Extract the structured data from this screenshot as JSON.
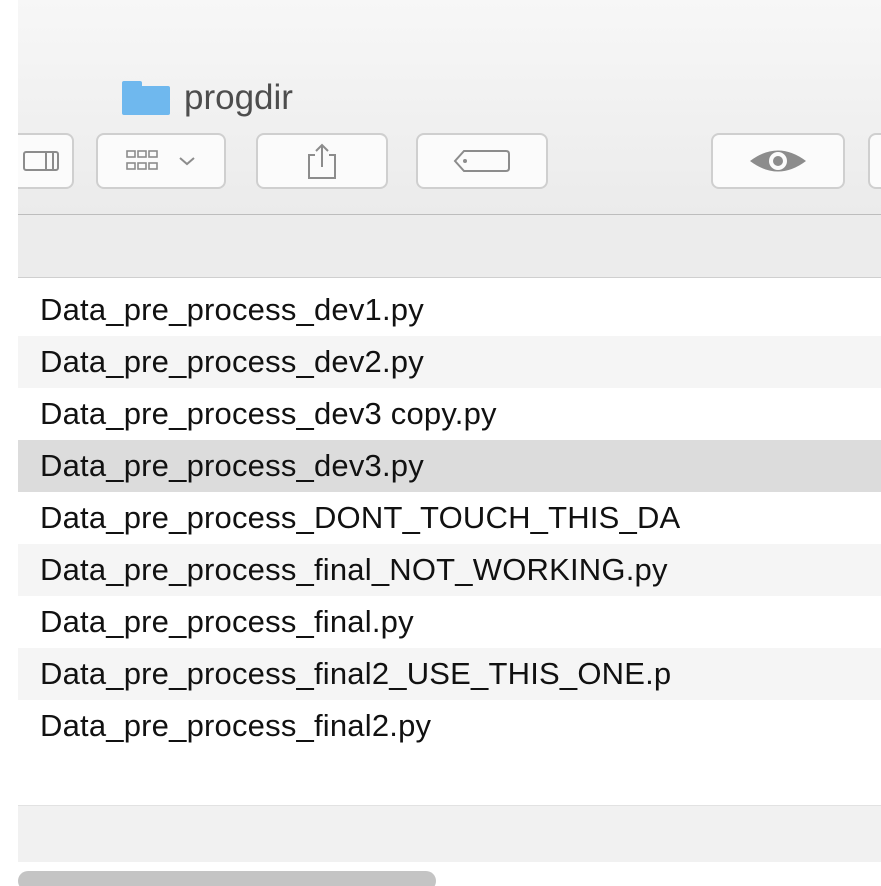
{
  "window": {
    "title": "progdir"
  },
  "toolbar": {
    "icons": {
      "columns": "column-view-icon",
      "arrange": "arrange-grid-icon",
      "share": "share-icon",
      "tag": "tag-icon",
      "quicklook": "eye-icon"
    }
  },
  "files": [
    {
      "name": "Data_pre_process_dev1.py"
    },
    {
      "name": "Data_pre_process_dev2.py"
    },
    {
      "name": "Data_pre_process_dev3 copy.py"
    },
    {
      "name": "Data_pre_process_dev3.py"
    },
    {
      "name": "Data_pre_process_DONT_TOUCH_THIS_DA"
    },
    {
      "name": "Data_pre_process_final_NOT_WORKING.py"
    },
    {
      "name": "Data_pre_process_final.py"
    },
    {
      "name": "Data_pre_process_final2_USE_THIS_ONE.p"
    },
    {
      "name": "Data_pre_process_final2.py"
    }
  ],
  "colors": {
    "folder": "#6fb8ee",
    "selected_row": "#dcdcdc",
    "alt_row": "#f5f5f5"
  }
}
